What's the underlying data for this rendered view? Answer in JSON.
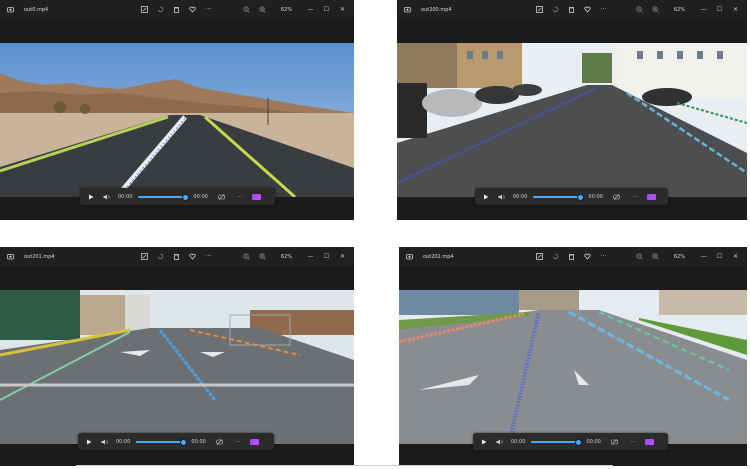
{
  "colors": {
    "accent": "#4aa8ff",
    "titlebar": "#202020",
    "viewer_bg": "#1b1b1b",
    "controls_bg": "#2b2b2b",
    "clip_icon": "#a24dff"
  },
  "windows": [
    {
      "id": "w1",
      "file_name": "out0.mp4",
      "zoom": "62%",
      "elapsed": "00:00",
      "remaining": "00:00",
      "progress": 0.96,
      "more": "···",
      "close": "✕",
      "maximize": "☐",
      "minimize": "—"
    },
    {
      "id": "w2",
      "file_name": "out200.mp4",
      "zoom": "62%",
      "elapsed": "00:00",
      "remaining": "00:00",
      "progress": 0.96,
      "more": "···",
      "close": "✕",
      "maximize": "☐",
      "minimize": "—"
    },
    {
      "id": "w3",
      "file_name": "out201.mp4",
      "zoom": "62%",
      "elapsed": "00:00",
      "remaining": "00:00",
      "progress": 0.96,
      "more": "···",
      "close": "✕",
      "maximize": "☐",
      "minimize": "—"
    },
    {
      "id": "w4",
      "file_name": "out202.mp4",
      "zoom": "62%",
      "elapsed": "00:00",
      "remaining": "00:00",
      "progress": 0.96,
      "more": "···",
      "close": "✕",
      "maximize": "☐",
      "minimize": "—"
    }
  ],
  "icons": {
    "app": "photos-app-icon",
    "toolbar": [
      "edit-image-icon",
      "rotate-icon",
      "delete-icon",
      "favorite-icon",
      "more-options-icon",
      "zoom-out-icon",
      "zoom-in-icon"
    ],
    "window": [
      "minimize-icon",
      "maximize-icon",
      "close-icon"
    ],
    "controls": [
      "play-icon",
      "volume-icon",
      "repeat-icon",
      "more-icon",
      "video-editor-icon"
    ]
  }
}
